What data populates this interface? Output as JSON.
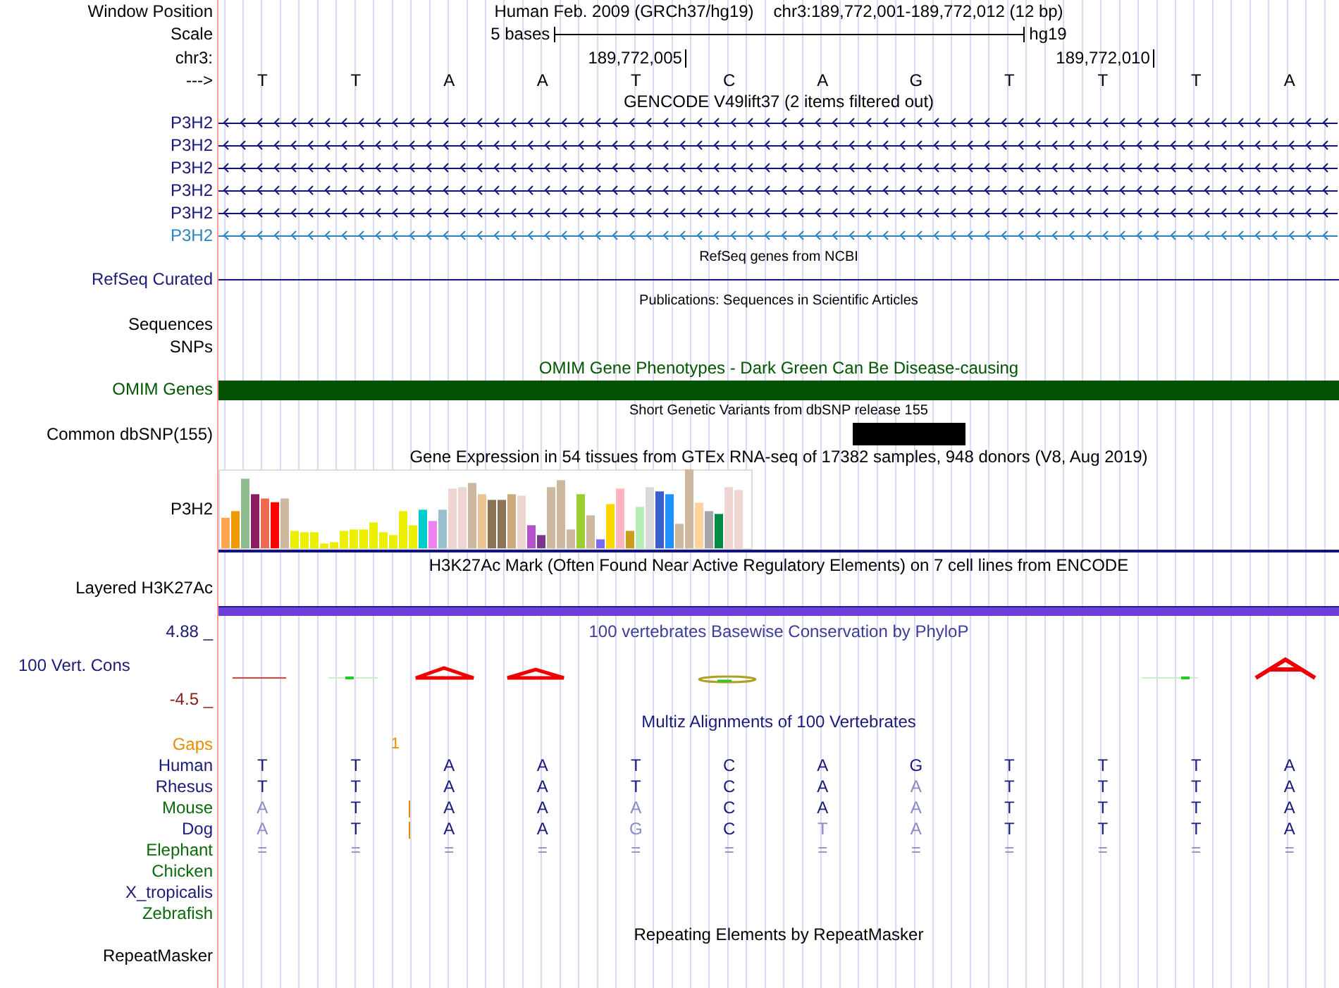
{
  "header": {
    "window_label": "Window Position",
    "assembly": "Human Feb. 2009 (GRCh37/hg19)",
    "range": "chr3:189,772,001-189,772,012 (12 bp)",
    "scale_label": "Scale",
    "scale_text": "5 bases",
    "scale_db": "hg19",
    "chrom_label": "chr3:",
    "tick_labels": [
      "189,772,005",
      "189,772,010"
    ],
    "strand_label": "--->",
    "bases": [
      {
        "base": "T"
      },
      {
        "base": "T",
        "gap_count": "1"
      },
      {
        "base": "A"
      },
      {
        "base": "A"
      },
      {
        "base": "T"
      },
      {
        "base": "C"
      },
      {
        "base": "A"
      },
      {
        "base": "G"
      },
      {
        "base": "T"
      },
      {
        "base": "T"
      },
      {
        "base": "T"
      },
      {
        "base": "A"
      }
    ]
  },
  "gencode": {
    "title": "GENCODE V49lift37 (2 items filtered out)",
    "transcripts": [
      {
        "label": "P3H2",
        "color": "#14147a"
      },
      {
        "label": "P3H2",
        "color": "#14147a"
      },
      {
        "label": "P3H2",
        "color": "#14147a"
      },
      {
        "label": "P3H2",
        "color": "#14147a"
      },
      {
        "label": "P3H2",
        "color": "#14147a"
      },
      {
        "label": "P3H2",
        "color": "#2b83c0"
      }
    ]
  },
  "refseq": {
    "title": "RefSeq genes from NCBI",
    "label": "RefSeq Curated"
  },
  "publications": {
    "title": "Publications: Sequences in Scientific Articles",
    "labels": [
      "Sequences",
      "SNPs"
    ]
  },
  "omim": {
    "title": "OMIM Gene Phenotypes - Dark Green Can Be Disease-causing",
    "label": "OMIM Genes"
  },
  "dbsnp": {
    "title": "Short Genetic Variants from dbSNP release 155",
    "label": "Common dbSNP(155)"
  },
  "gtex": {
    "title": "Gene Expression in 54 tissues from GTEx RNA-seq of 17382 samples, 948 donors (V8, Aug 2019)",
    "label": "P3H2"
  },
  "h3k27ac": {
    "title": "H3K27Ac Mark (Often Found Near Active Regulatory Elements) on 7 cell lines from ENCODE",
    "label": "Layered H3K27Ac"
  },
  "conservation": {
    "title": "100 vertebrates Basewise Conservation by PhyloP",
    "label": "100 Vert. Cons",
    "max_label": "4.88 _",
    "min_label": "-4.5 _"
  },
  "multiz": {
    "title": "Multiz Alignments of 100 Vertebrates",
    "gaps_label": "Gaps",
    "species": [
      {
        "label": "Human",
        "color": "#1a1a7a",
        "bases": [
          {
            "base": "T",
            "match": true
          },
          {
            "base": "T",
            "match": true
          },
          {
            "base": "A",
            "match": true
          },
          {
            "base": "A",
            "match": true
          },
          {
            "base": "T",
            "match": true
          },
          {
            "base": "C",
            "match": true
          },
          {
            "base": "A",
            "match": true
          },
          {
            "base": "G",
            "match": true
          },
          {
            "base": "T",
            "match": true
          },
          {
            "base": "T",
            "match": true
          },
          {
            "base": "T",
            "match": true
          },
          {
            "base": "A",
            "match": true
          }
        ]
      },
      {
        "label": "Rhesus",
        "color": "#1a1a7a",
        "bases": [
          {
            "base": "T",
            "match": true
          },
          {
            "base": "T",
            "match": true
          },
          {
            "base": "A",
            "match": true
          },
          {
            "base": "A",
            "match": true
          },
          {
            "base": "T",
            "match": true
          },
          {
            "base": "C",
            "match": true
          },
          {
            "base": "A",
            "match": true
          },
          {
            "base": "A",
            "match": false
          },
          {
            "base": "T",
            "match": true
          },
          {
            "base": "T",
            "match": true
          },
          {
            "base": "T",
            "match": true
          },
          {
            "base": "A",
            "match": true
          }
        ]
      },
      {
        "label": "Mouse",
        "color": "#0a6a0a",
        "bases": [
          {
            "base": "A",
            "match": false
          },
          {
            "base": "T",
            "match": true,
            "insertion": true
          },
          {
            "base": "A",
            "match": true
          },
          {
            "base": "A",
            "match": true
          },
          {
            "base": "A",
            "match": false
          },
          {
            "base": "C",
            "match": true
          },
          {
            "base": "A",
            "match": true
          },
          {
            "base": "A",
            "match": false
          },
          {
            "base": "T",
            "match": true
          },
          {
            "base": "T",
            "match": true
          },
          {
            "base": "T",
            "match": true
          },
          {
            "base": "A",
            "match": true
          }
        ]
      },
      {
        "label": "Dog",
        "color": "#1a1a7a",
        "bases": [
          {
            "base": "A",
            "match": false
          },
          {
            "base": "T",
            "match": true,
            "insertion": true
          },
          {
            "base": "A",
            "match": true
          },
          {
            "base": "A",
            "match": true
          },
          {
            "base": "G",
            "match": false
          },
          {
            "base": "C",
            "match": true
          },
          {
            "base": "T",
            "match": false
          },
          {
            "base": "A",
            "match": false
          },
          {
            "base": "T",
            "match": true
          },
          {
            "base": "T",
            "match": true
          },
          {
            "base": "T",
            "match": true
          },
          {
            "base": "A",
            "match": true
          }
        ]
      },
      {
        "label": "Elephant",
        "color": "#0a6a0a",
        "bases": [
          {
            "base": "=",
            "match": false
          },
          {
            "base": "=",
            "match": false
          },
          {
            "base": "=",
            "match": false
          },
          {
            "base": "=",
            "match": false
          },
          {
            "base": "=",
            "match": false
          },
          {
            "base": "=",
            "match": false
          },
          {
            "base": "=",
            "match": false
          },
          {
            "base": "=",
            "match": false
          },
          {
            "base": "=",
            "match": false
          },
          {
            "base": "=",
            "match": false
          },
          {
            "base": "=",
            "match": false
          },
          {
            "base": "=",
            "match": false
          }
        ]
      },
      {
        "label": "Chicken",
        "color": "#0a6a0a"
      },
      {
        "label": "X_tropicalis",
        "color": "#1a1a7a"
      },
      {
        "label": "Zebrafish",
        "color": "#0a6a0a"
      }
    ]
  },
  "repeatmasker": {
    "title": "Repeating Elements by RepeatMasker",
    "label": "RepeatMasker"
  }
}
